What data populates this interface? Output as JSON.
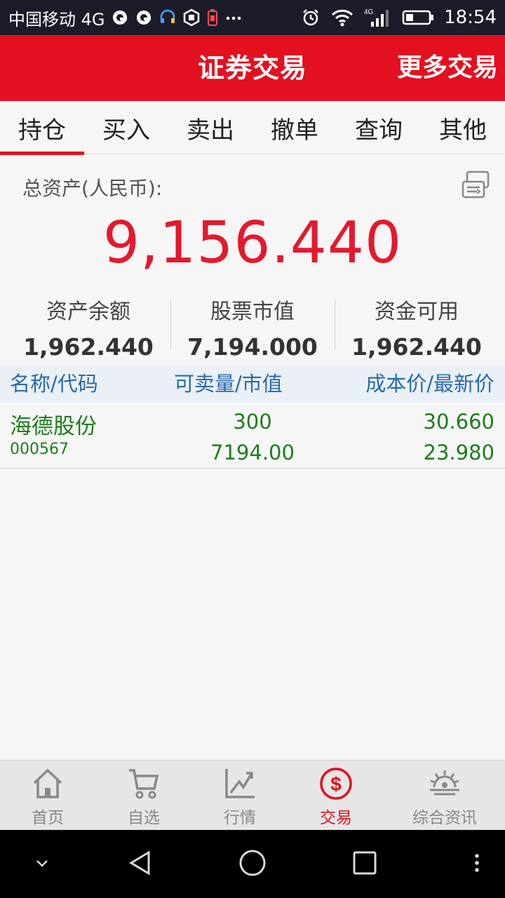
{
  "status_bar": {
    "carrier": "中国移动 4G",
    "network_badge": "4G",
    "time": "18:54",
    "icons": [
      "qq-icon",
      "qq-icon",
      "headset-icon",
      "hexagon-icon",
      "battery-warning-icon",
      "more-dots-icon",
      "alarm-icon",
      "wifi-icon",
      "signal-icon",
      "battery-icon"
    ]
  },
  "header": {
    "title": "证券交易",
    "more": "更多交易"
  },
  "tabs": [
    {
      "label": "持仓"
    },
    {
      "label": "买入"
    },
    {
      "label": "卖出"
    },
    {
      "label": "撤单"
    },
    {
      "label": "查询"
    },
    {
      "label": "其他"
    }
  ],
  "assets": {
    "total_label": "总资产(人民币):",
    "total_value": "9,156.440",
    "stats": [
      {
        "label": "资产余额",
        "value": "1,962.440"
      },
      {
        "label": "股票市值",
        "value": "7,194.000"
      },
      {
        "label": "资金可用",
        "value": "1,962.440"
      }
    ]
  },
  "table": {
    "headers": [
      "名称/代码",
      "可卖量/市值",
      "成本价/最新价"
    ],
    "rows": [
      {
        "name": "海德股份",
        "code": "000567",
        "qty": "300",
        "market_value": "7194.00",
        "cost": "30.660",
        "last": "23.980"
      }
    ]
  },
  "bottom_nav": [
    {
      "label": "首页",
      "icon": "home-icon"
    },
    {
      "label": "自选",
      "icon": "cart-icon"
    },
    {
      "label": "行情",
      "icon": "trend-chart-icon"
    },
    {
      "label": "交易",
      "icon": "dollar-icon"
    },
    {
      "label": "综合资讯",
      "icon": "sunrise-icon"
    }
  ],
  "colors": {
    "brand_red": "#e3101f",
    "value_red": "#e3192e",
    "gain_green": "#1e7d1e",
    "header_blue": "#2a6aa9"
  }
}
